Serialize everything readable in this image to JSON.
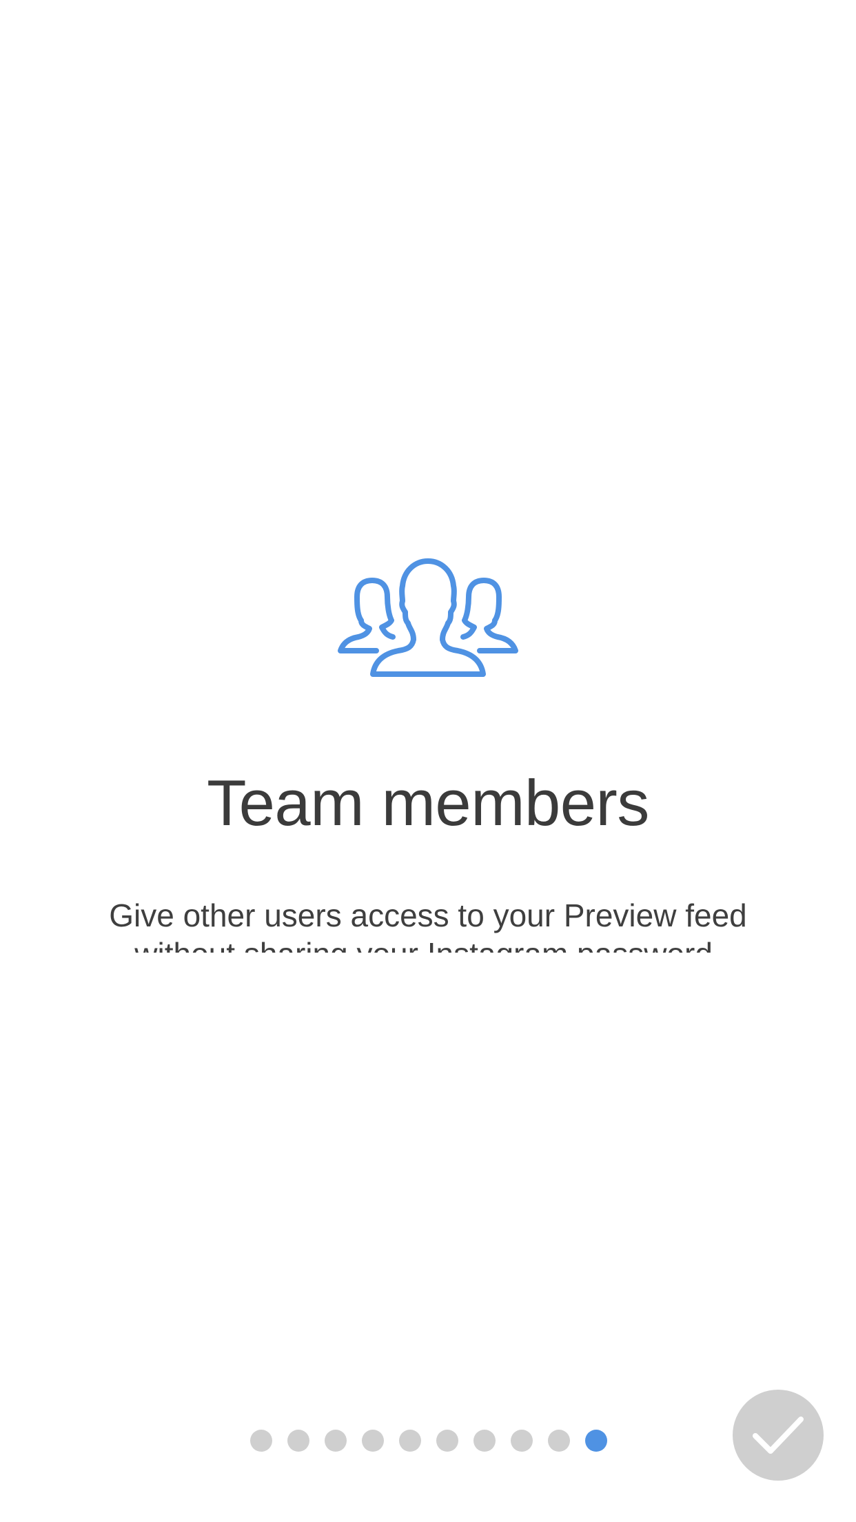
{
  "onboarding": {
    "icon": "team-members-icon",
    "title": "Team members",
    "description": "Give other users access to your Preview feed without sharing your Instagram password."
  },
  "pager": {
    "total_pages": 10,
    "active_index": 9,
    "active_color": "#4f92e3",
    "inactive_color": "#cfcfcf"
  },
  "done_button": {
    "icon": "checkmark-icon",
    "color": "#cfcfcf"
  }
}
